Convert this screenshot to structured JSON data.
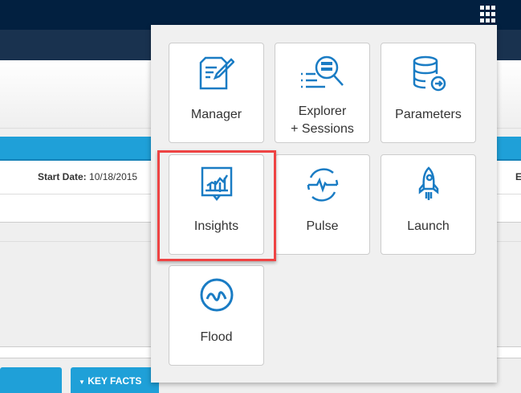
{
  "header": {
    "start_date_label": "Start Date:",
    "start_date_value": "10/18/2015",
    "truncated_label": "E"
  },
  "tabs": [
    {
      "label": ""
    },
    {
      "label": "KEY FACTS"
    }
  ],
  "app_menu": {
    "icon": "grid-icon",
    "highlight_color": "#ee4444",
    "accent": "#1a7cc4",
    "items": [
      {
        "label": "Manager",
        "icon": "document-edit-icon"
      },
      {
        "label_line1": "Explorer",
        "label_line2": "+ Sessions",
        "icon": "search-list-icon"
      },
      {
        "label": "Parameters",
        "icon": "database-icon"
      },
      {
        "label": "Insights",
        "icon": "chart-icon"
      },
      {
        "label": "Pulse",
        "icon": "pulse-icon"
      },
      {
        "label": "Launch",
        "icon": "rocket-icon"
      },
      {
        "label": "Flood",
        "icon": "wave-icon"
      }
    ]
  }
}
